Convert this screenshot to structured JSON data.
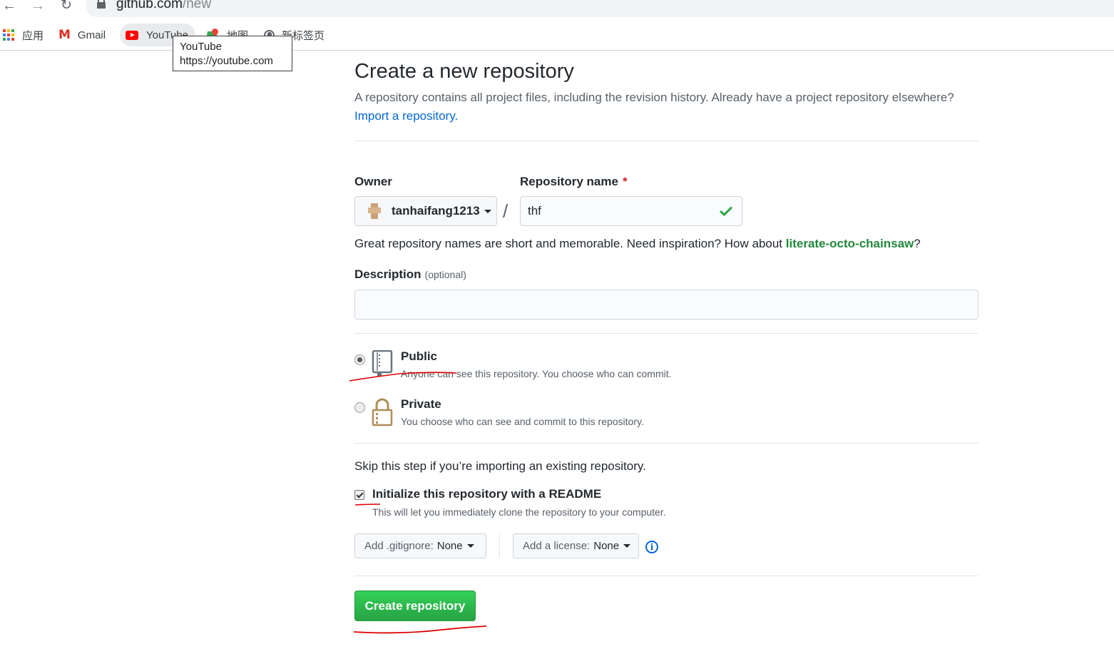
{
  "browser": {
    "url_host": "github.com",
    "url_path": "/new",
    "bookmarks": {
      "apps": "应用",
      "gmail": "Gmail",
      "youtube": "YouTube",
      "maps": "地图",
      "newtab": "新标签页"
    },
    "tooltip": {
      "title": "YouTube",
      "url": "https://youtube.com"
    }
  },
  "page": {
    "title": "Create a new repository",
    "subtitle": "A repository contains all project files, including the revision history. Already have a project repository elsewhere?",
    "import_link": "Import a repository.",
    "owner_label": "Owner",
    "owner_value": "tanhaifang1213",
    "slash": "/",
    "repo_name_label": "Repository name",
    "required_mark": "*",
    "repo_name_value": "thf",
    "hint_prefix": "Great repository names are short and memorable. Need inspiration? How about ",
    "hint_suggestion": "literate-octo-chainsaw",
    "hint_suffix": "?",
    "description_label": "Description",
    "description_optional": "(optional)",
    "description_value": "",
    "visibility": {
      "selected": "public",
      "public_title": "Public",
      "public_desc": "Anyone can see this repository. You choose who can commit.",
      "private_title": "Private",
      "private_desc": "You choose who can see and commit to this repository."
    },
    "skip_text": "Skip this step if you’re importing an existing repository.",
    "readme_checked": true,
    "readme_label": "Initialize this repository with a README",
    "readme_desc": "This will let you immediately clone the repository to your computer.",
    "gitignore_label": "Add .gitignore:",
    "gitignore_value": "None",
    "license_label": "Add a license:",
    "license_value": "None",
    "create_button": "Create repository"
  },
  "colors": {
    "link": "#0366d6",
    "create_button": "#2ea44f",
    "suggestion": "#22863a",
    "annotation": "#e00000"
  },
  "icons": [
    "back-arrow-icon",
    "forward-arrow-icon",
    "reload-icon",
    "lock-icon",
    "apps-grid-icon",
    "gmail-icon",
    "youtube-icon",
    "maps-icon",
    "globe-icon",
    "caret-down-icon",
    "check-icon",
    "repo-icon",
    "private-lock-icon",
    "info-icon"
  ]
}
